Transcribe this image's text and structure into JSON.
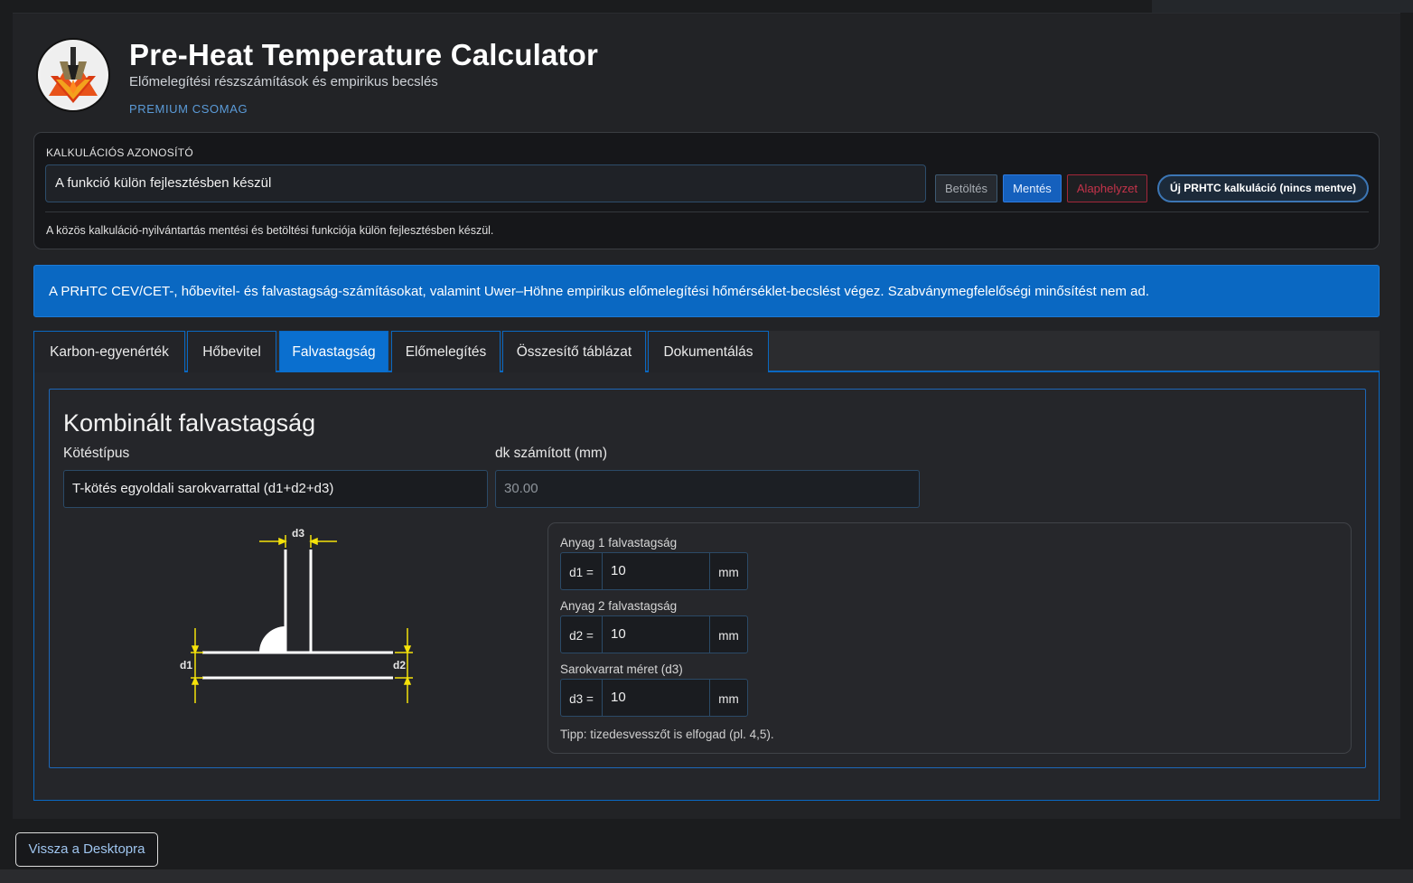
{
  "header": {
    "title": "Pre-Heat Temperature Calculator",
    "subtitle": "Előmelegítési részszámítások és empirikus becslés",
    "badge": "PREMIUM CSOMAG"
  },
  "calc_id": {
    "label": "KALKULÁCIÓS AZONOSÍTÓ",
    "value": "A funkció külön fejlesztésben készül",
    "load_label": "Betöltés",
    "save_label": "Mentés",
    "reset_label": "Alaphelyzet",
    "new_label": "Új PRHTC kalkuláció (nincs mentve)",
    "note": "A közös kalkuláció-nyilvántartás mentési és betöltési funkciója külön fejlesztésben készül."
  },
  "info": "A PRHTC CEV/CET-, hőbevitel- és falvastagság-számításokat, valamint Uwer–Höhne empirikus előmelegítési hőmérséklet-becslést végez. Szabványmegfelelőségi minősítést nem ad.",
  "tabs": [
    {
      "label": "Karbon-egyenérték"
    },
    {
      "label": "Hőbevitel"
    },
    {
      "label": "Falvastagság",
      "active": true
    },
    {
      "label": "Előmelegítés"
    },
    {
      "label": "Összesítő táblázat"
    },
    {
      "label": "Dokumentálás"
    }
  ],
  "section": {
    "title": "Kombinált falvastagság",
    "joint_label": "Kötéstípus",
    "joint_value": "T-kötés egyoldali sarokvarrattal (d1+d2+d3)",
    "dk_label": "dk számított (mm)",
    "dk_value": "30.00"
  },
  "diagram": {
    "d1": "d1",
    "d2": "d2",
    "d3": "d3"
  },
  "thickness": {
    "items": [
      {
        "label": "Anyag 1 falvastagság",
        "prefix": "d1 =",
        "value": "10",
        "unit": "mm"
      },
      {
        "label": "Anyag 2 falvastagság",
        "prefix": "d2 =",
        "value": "10",
        "unit": "mm"
      },
      {
        "label": "Sarokvarrat méret (d3)",
        "prefix": "d3 =",
        "value": "10",
        "unit": "mm"
      }
    ],
    "tip": "Tipp: tizedesvesszőt is elfogad (pl. 4,5)."
  },
  "footer": {
    "back_label": "Vissza a Desktopra"
  },
  "colors": {
    "accent": "#0a68c2",
    "danger": "#c4334a",
    "dimension": "#f5e20a"
  }
}
